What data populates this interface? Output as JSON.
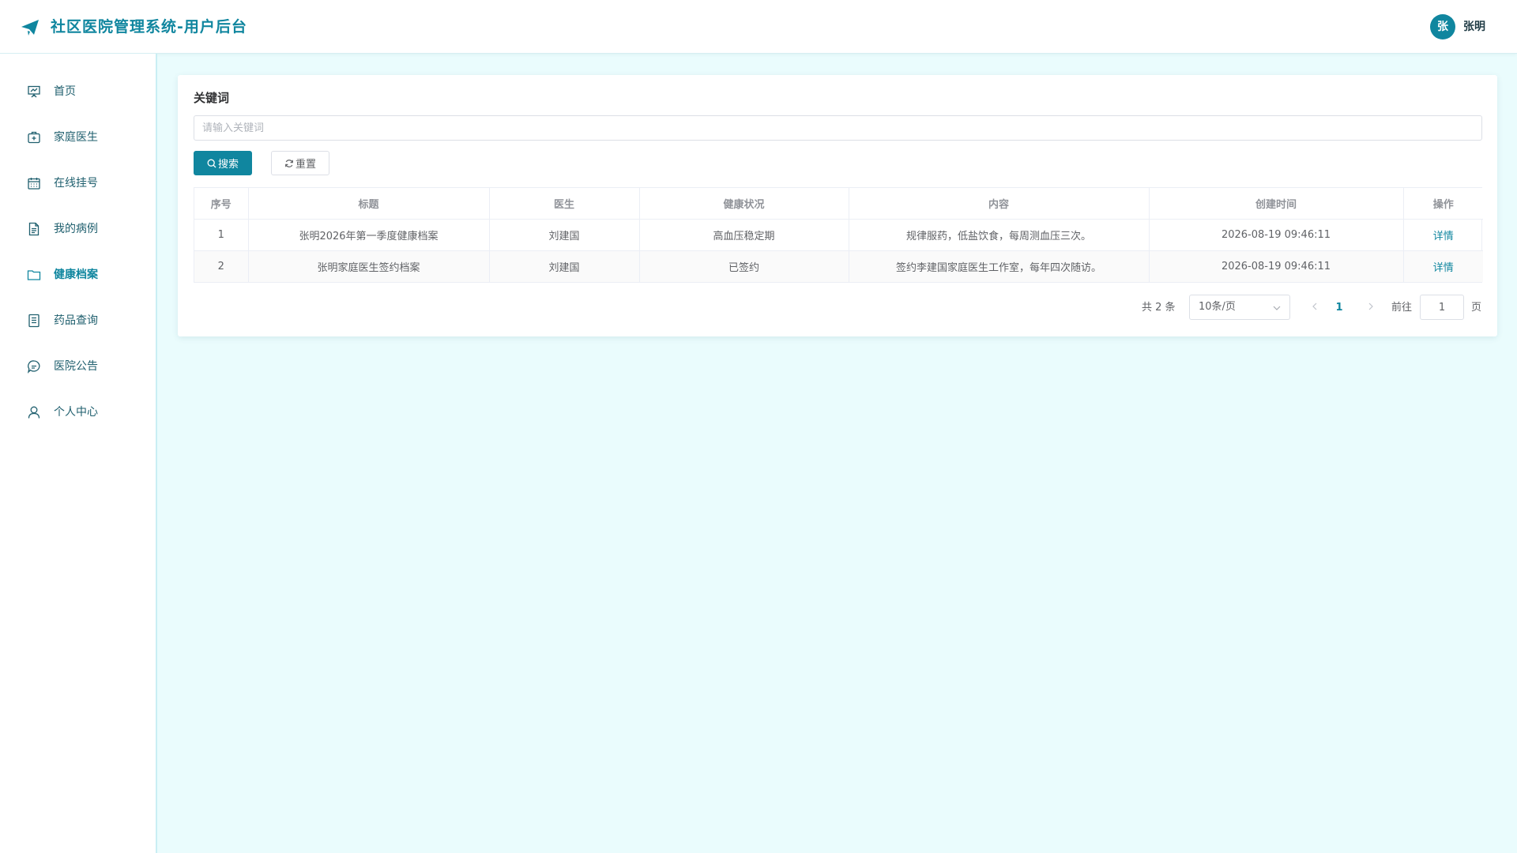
{
  "header": {
    "app_title": "社区医院管理系统-用户后台",
    "avatar_initial": "张",
    "user_name": "张明",
    "accent_color": "#10869f"
  },
  "sidebar": {
    "items": [
      {
        "label": "首页",
        "icon": "presentation-chart-icon"
      },
      {
        "label": "家庭医生",
        "icon": "medical-kit-icon"
      },
      {
        "label": "在线挂号",
        "icon": "calendar-icon"
      },
      {
        "label": "我的病例",
        "icon": "document-icon"
      },
      {
        "label": "健康档案",
        "icon": "folder-icon",
        "active": true
      },
      {
        "label": "药品查询",
        "icon": "list-document-icon"
      },
      {
        "label": "医院公告",
        "icon": "chat-bubble-icon"
      },
      {
        "label": "个人中心",
        "icon": "user-icon"
      }
    ]
  },
  "search": {
    "label": "关键词",
    "placeholder": "请输入关键词",
    "value": "",
    "search_button": "搜索",
    "reset_button": "重置"
  },
  "table": {
    "columns": [
      "序号",
      "标题",
      "医生",
      "健康状况",
      "内容",
      "创建时间",
      "操作"
    ],
    "rows": [
      {
        "index": "1",
        "title": "张明2026年第一季度健康档案",
        "doctor": "刘建国",
        "status": "高血压稳定期",
        "content": "规律服药，低盐饮食，每周测血压三次。",
        "created": "2026-08-19 09:46:11",
        "action": "详情"
      },
      {
        "index": "2",
        "title": "张明家庭医生签约档案",
        "doctor": "刘建国",
        "status": "已签约",
        "content": "签约李建国家庭医生工作室，每年四次随访。",
        "created": "2026-08-19 09:46:11",
        "action": "详情"
      }
    ]
  },
  "pagination": {
    "total_text": "共 2 条",
    "page_size": "10条/页",
    "current_page": "1",
    "goto_label": "前往",
    "goto_value": "1",
    "page_suffix": "页"
  }
}
